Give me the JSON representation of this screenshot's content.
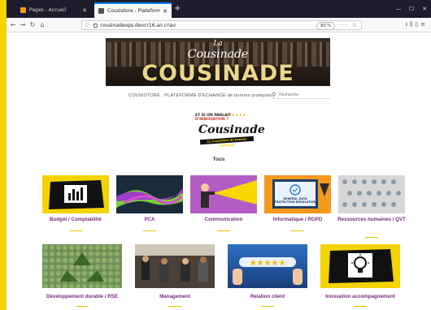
{
  "browser": {
    "tabs": [
      {
        "label": "Pages - Accueil",
        "favicon_color": "#f39c12"
      },
      {
        "label": "Cousistore - Plateforme d'éch",
        "favicon_color": "#555555"
      }
    ],
    "new_tab": "+",
    "url": "cousinadeops.devcr16.an.cnav",
    "zoom": "80 %"
  },
  "site": {
    "banner_script_small": "La",
    "banner_script": "Cousinade",
    "banner_word": "COUSINADE",
    "subtitle": "COUSISTORE : PLATEFORME D'ECHANGE de bonnes pratiques",
    "search_placeholder": "Recherche",
    "logo": {
      "line1": "ET SI ON PARLAIT",
      "line2": "D'INNOVATION ?",
      "brand": "Cousinade",
      "tagline": "Le Cousistore de bonnes pratiques"
    },
    "tous": "Tous"
  },
  "categories": [
    {
      "label": "Budget / Comptabilité"
    },
    {
      "label": "PCA"
    },
    {
      "label": "Communication"
    },
    {
      "label": "Informatique / RGPD"
    },
    {
      "label": "Ressources humaines / QVT"
    },
    {
      "label": "Développement durable / RSE"
    },
    {
      "label": "Management"
    },
    {
      "label": "Relation client"
    },
    {
      "label": "Innovation accompagnement"
    }
  ],
  "colors": {
    "accent_yellow": "#f4d400",
    "category_text": "#7a2a82"
  }
}
